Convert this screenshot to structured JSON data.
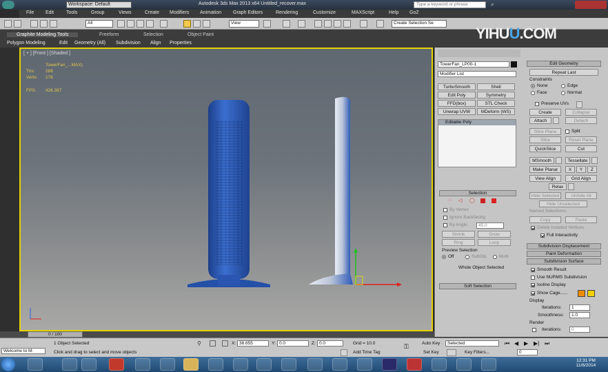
{
  "titlebar": {
    "workspace": "Workspace: Default",
    "title": "Autodesk 3ds Max 2013 x64    Untitled_recover.max",
    "search_placeholder": "Type a keyword or phrase"
  },
  "menu": [
    "File",
    "Edit",
    "Tools",
    "Group",
    "Views",
    "Create",
    "Modifiers",
    "Animation",
    "Graph Editors",
    "Rendering",
    "Customize",
    "MAXScript",
    "Help",
    "GoZ"
  ],
  "toolbar": {
    "filter": "All",
    "view": "View",
    "selection_set": "Create Selection Se"
  },
  "ribbon": {
    "tabs": [
      "Graphite Modeling Tools",
      "Freeform",
      "Selection",
      "Object Paint"
    ],
    "subtabs": [
      "Polygon Modeling",
      "Edit",
      "Geometry (All)",
      "Subdivision",
      "Align",
      "Properties"
    ]
  },
  "watermark": {
    "part1": "YIHU",
    "part2": "U",
    "part3": ".COM"
  },
  "viewport": {
    "label": "[ + ] [Front ] [Shaded ]",
    "object_name": "TowerFan_...MAX)",
    "tris_label": "Tris:",
    "tris": "288",
    "verts_label": "Verts:",
    "verts": "176",
    "fps_label": "FPS:",
    "fps": "426.387"
  },
  "command_panel": {
    "object_name": "TowerFan_LP00-1",
    "modifier_list": "Modifier List",
    "modifier_buttons": [
      "TurboSmooth",
      "Shell",
      "Edit Poly",
      "Symmetry",
      "FFD(box)",
      "STL Check",
      "Unwrap UVW",
      "MDeform (WS)"
    ],
    "stack_item": "Editable Poly",
    "selection": {
      "header": "Selection",
      "by_vertex": "By Vertex",
      "ignore_backfacing": "Ignore Backfacing",
      "by_angle": "By Angle:",
      "by_angle_value": "45.0",
      "shrink": "Shrink",
      "grow": "Grow",
      "ring": "Ring",
      "loop": "Loop",
      "preview": "Preview Selection",
      "off": "Off",
      "subobj": "SubObj",
      "multi": "Multi",
      "status": "Whole Object Selected"
    },
    "soft_selection": "Soft Selection"
  },
  "edit_geometry": {
    "header": "Edit Geometry",
    "repeat_last": "Repeat Last",
    "constraints": "Constraints",
    "none": "None",
    "edge": "Edge",
    "face": "Face",
    "normal": "Normal",
    "preserve_uvs": "Preserve UVs",
    "create": "Create",
    "collapse": "Collapse",
    "attach": "Attach",
    "detach": "Detach",
    "slice_plane": "Slice Plane",
    "split": "Split",
    "slice": "Slice",
    "reset_plane": "Reset Plane",
    "quickslice": "QuickSlice",
    "cut": "Cut",
    "msmooth": "MSmooth",
    "tessellate": "Tessellate",
    "make_planar": "Make Planar",
    "x": "X",
    "y": "Y",
    "z": "Z",
    "view_align": "View Align",
    "grid_align": "Grid Align",
    "relax": "Relax",
    "hide_selected": "Hide Selected",
    "unhide_all": "Unhide All",
    "hide_unselected": "Hide Unselected",
    "named_selections": "Named Selections:",
    "copy": "Copy",
    "paste": "Paste",
    "delete_isolated": "Delete Isolated Vertices",
    "full_interactivity": "Full Interactivity"
  },
  "rollouts": {
    "subdivision_displacement": "Subdivision Displacement",
    "paint_deformation": "Paint Deformation",
    "subdivision_surface": "Subdivision Surface"
  },
  "subdivision": {
    "smooth_result": "Smooth Result",
    "use_nurms": "Use NURMS Subdivision",
    "isoline": "Isoline Display",
    "show_cage": "Show Cage......",
    "display": "Display",
    "iterations": "Iterations:",
    "iterations_value": "1",
    "smoothness": "Smoothness:",
    "smoothness_value": "1.0",
    "render": "Render",
    "render_iterations": "Iterations:",
    "render_iterations_value": "0"
  },
  "status": {
    "frame": "0 / 100",
    "maxscript": "Welcome to M:",
    "selected": "1 Object Selected",
    "prompt": "Click and drag to select and move objects",
    "x_label": "X:",
    "x": "38.655",
    "y_label": "Y:",
    "y": "0.0",
    "z_label": "Z:",
    "z": "0.0",
    "grid": "Grid = 10.0",
    "add_time_tag": "Add Time Tag",
    "auto_key": "Auto Key",
    "set_key": "Set Key",
    "selected_dropdown": "Selected",
    "key_filters": "Key Filters...",
    "frame_field": "0"
  },
  "clock": {
    "time": "12:31 PM",
    "date": "11/6/2014"
  },
  "colors": {
    "viewport_border": "#e6d200",
    "mesh_blue": "#2e5bb8",
    "stats_text": "#e3c64b"
  }
}
